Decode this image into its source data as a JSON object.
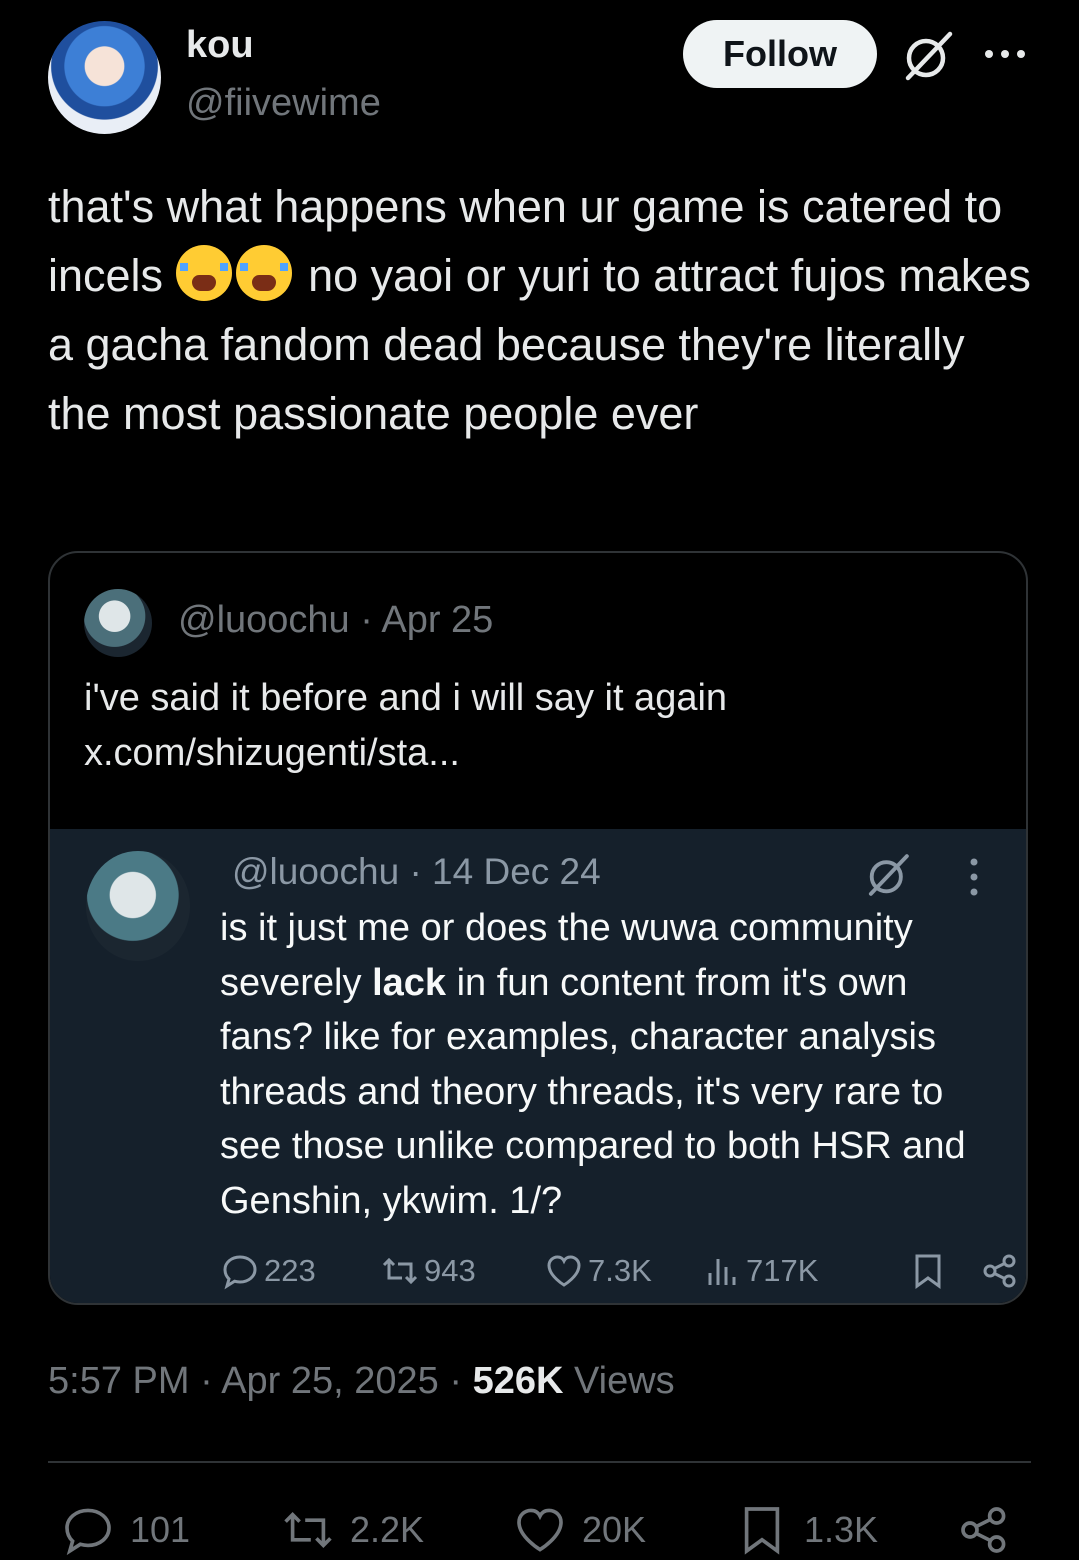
{
  "author": {
    "display_name": "kou",
    "handle": "@fiivewime",
    "follow_label": "Follow"
  },
  "tweet": {
    "text_part1": "that's what happens when ur game is catered to incels ",
    "emojis": [
      "loudly-crying-face",
      "loudly-crying-face"
    ],
    "text_part2": " no yaoi or yuri to attract fujos makes a gacha fandom dead because they're literally the most passionate people ever"
  },
  "quote": {
    "header": "@luoochu · Apr 25",
    "text": "i've said it before and i will say it again x.com/shizugenti/sta..."
  },
  "embed": {
    "header": "@luoochu · 14 Dec 24",
    "text_before": "is it just me or does the wuwa community severely ",
    "text_bold": "lack",
    "text_after": " in fun content from it's own fans? like for examples, character analysis threads and theory threads, it's very rare to see those unlike compared to both HSR and Genshin, ykwim. 1/?",
    "replies": "223",
    "reposts": "943",
    "likes": "7.3K",
    "views": "717K"
  },
  "meta": {
    "time_date": "5:57 PM · Apr 25, 2025 · ",
    "views_count": "526K",
    "views_label": " Views"
  },
  "actions": {
    "replies": "101",
    "reposts": "2.2K",
    "likes": "20K",
    "bookmarks": "1.3K"
  },
  "colors": {
    "background": "#000000",
    "text": "#e7e9ea",
    "muted": "#71767b",
    "embed_bg": "#15202b",
    "follow_bg": "#eff3f4"
  }
}
